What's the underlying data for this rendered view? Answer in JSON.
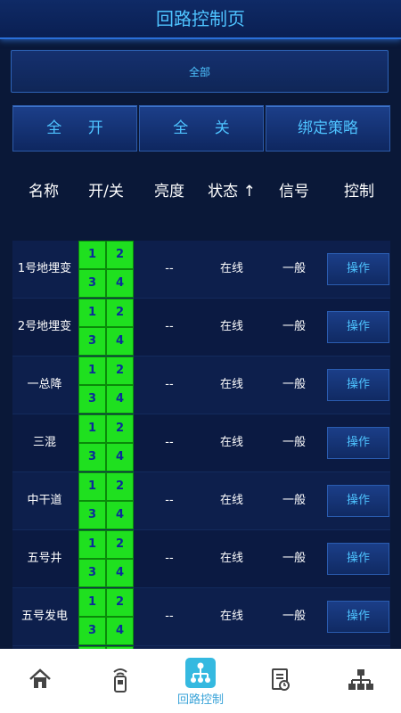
{
  "header": {
    "title": "回路控制页"
  },
  "filter": {
    "label": "全部"
  },
  "actions": {
    "all_on": "全 开",
    "all_off": "全 关",
    "bind_policy": "绑定策略"
  },
  "columns": {
    "name": "名称",
    "switch": "开/关",
    "brightness": "亮度",
    "status": "状态 ↑",
    "signal": "信号",
    "control": "控制"
  },
  "rows": [
    {
      "name": "1号地埋变",
      "switches": [
        "1",
        "2",
        "3",
        "4"
      ],
      "brightness": "--",
      "status": "在线",
      "signal": "一般",
      "op": "操作"
    },
    {
      "name": "2号地埋变",
      "switches": [
        "1",
        "2",
        "3",
        "4"
      ],
      "brightness": "--",
      "status": "在线",
      "signal": "一般",
      "op": "操作"
    },
    {
      "name": "一总降",
      "switches": [
        "1",
        "2",
        "3",
        "4"
      ],
      "brightness": "--",
      "status": "在线",
      "signal": "一般",
      "op": "操作"
    },
    {
      "name": "三混",
      "switches": [
        "1",
        "2",
        "3",
        "4"
      ],
      "brightness": "--",
      "status": "在线",
      "signal": "一般",
      "op": "操作"
    },
    {
      "name": "中干道",
      "switches": [
        "1",
        "2",
        "3",
        "4"
      ],
      "brightness": "--",
      "status": "在线",
      "signal": "一般",
      "op": "操作"
    },
    {
      "name": "五号井",
      "switches": [
        "1",
        "2",
        "3",
        "4"
      ],
      "brightness": "--",
      "status": "在线",
      "signal": "一般",
      "op": "操作"
    },
    {
      "name": "五号发电",
      "switches": [
        "1",
        "2",
        "3",
        "4"
      ],
      "brightness": "--",
      "status": "在线",
      "signal": "一般",
      "op": "操作"
    }
  ],
  "nav": {
    "active_label": "回路控制",
    "items": [
      {
        "icon": "home-icon"
      },
      {
        "icon": "mobile-device-icon"
      },
      {
        "icon": "loop-control-icon",
        "label": "回路控制"
      },
      {
        "icon": "document-icon"
      },
      {
        "icon": "network-icon"
      }
    ]
  },
  "colors": {
    "accent": "#4ec3ff",
    "switch_on": "#1fe01f",
    "background": "#0a1838",
    "nav_active": "#35b9e0"
  }
}
